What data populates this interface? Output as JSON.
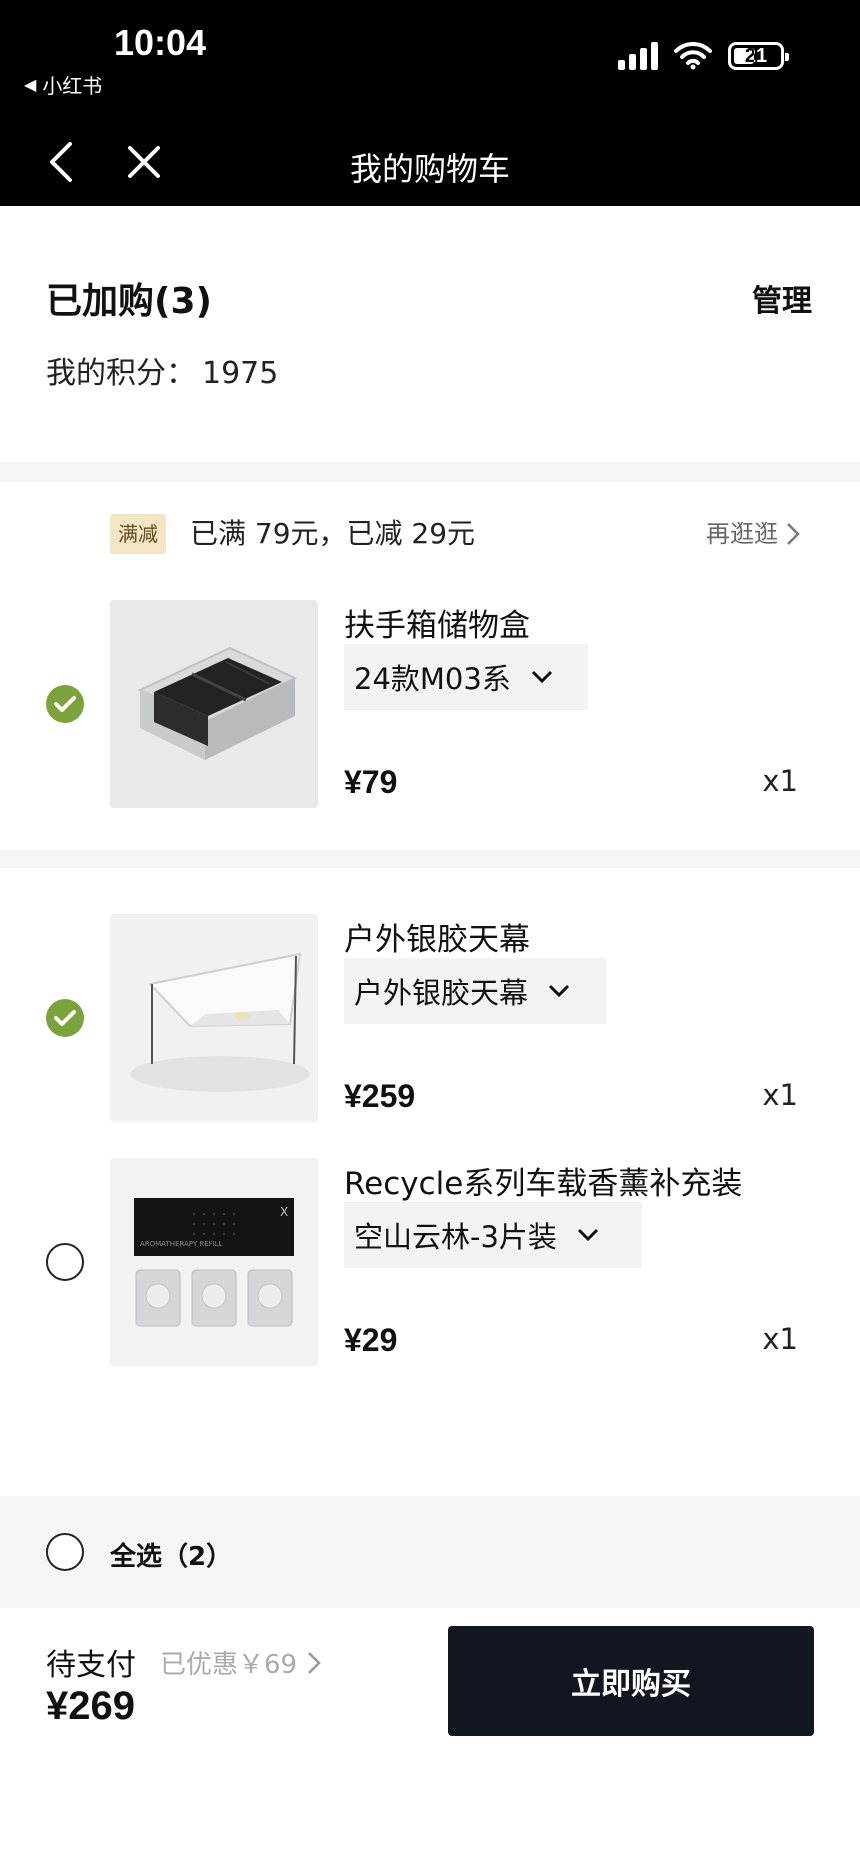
{
  "status_bar": {
    "time": "10:04",
    "back_app": "小红书",
    "battery": "21"
  },
  "nav": {
    "title": "我的购物车"
  },
  "summary": {
    "title": "已加购(3)",
    "manage": "管理",
    "points_label": "我的积分：",
    "points_value": "1975"
  },
  "promo": {
    "tag": "满减",
    "text": "已满 79元，已减 29元",
    "more": "再逛逛"
  },
  "items": [
    {
      "name": "扶手箱储物盒",
      "variant": "24款M03系",
      "price": "¥79",
      "qty": "x1",
      "checked": true
    },
    {
      "name": "户外银胶天幕",
      "variant": "户外银胶天幕",
      "price": "¥259",
      "qty": "x1",
      "checked": true
    },
    {
      "name": "Recycle系列车载香薰补充装",
      "variant": "空山云林-3片装",
      "price": "¥29",
      "qty": "x1",
      "checked": false
    }
  ],
  "select_all": {
    "label": "全选（2）"
  },
  "footer": {
    "pay_label": "待支付",
    "saved": "已优惠￥69",
    "total": "¥269",
    "buy_button": "立即购买"
  },
  "colors": {
    "check_green": "#7ba33b",
    "buy_button": "#111620",
    "promo_tag_bg": "#f4e6c4"
  }
}
